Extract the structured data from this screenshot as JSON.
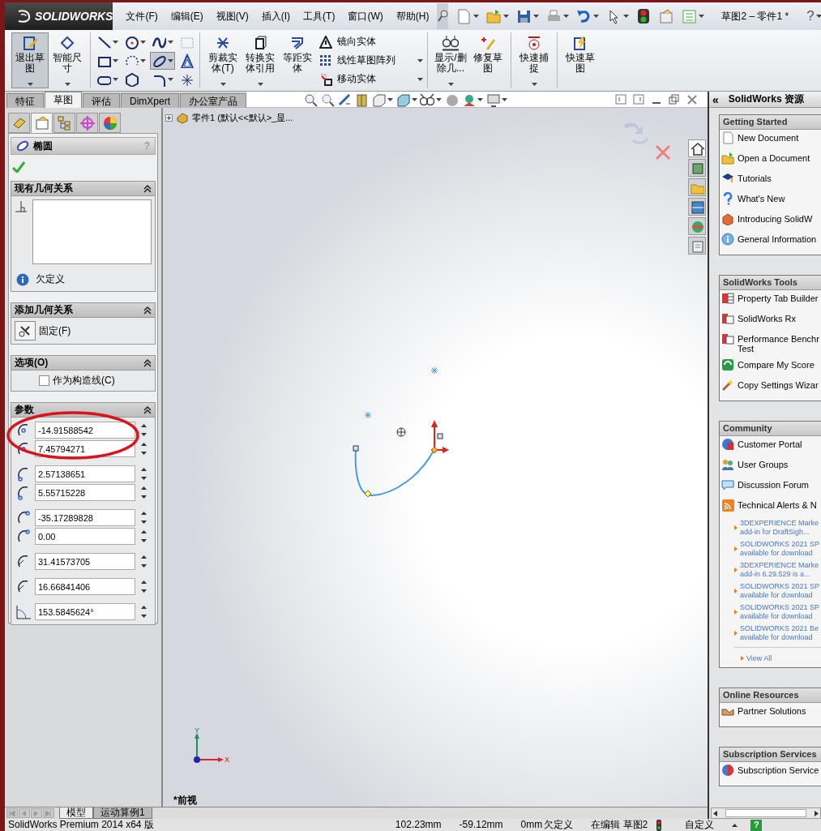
{
  "app": {
    "logo": "SOLIDWORKS",
    "menus": [
      "文件(F)",
      "编辑(E)",
      "视图(V)",
      "插入(I)",
      "工具(T)",
      "窗口(W)",
      "帮助(H)"
    ],
    "document_title": "草图2 – 零件1 *",
    "help": "?"
  },
  "command_manager": {
    "sketch_buttons": [
      {
        "label": "退出草图",
        "selected": true
      },
      {
        "label": "智能尺寸",
        "selected": false
      }
    ],
    "sketch_tools": [
      {
        "selected": false
      },
      {
        "selected": false
      },
      {
        "selected": false
      },
      {
        "selected": false
      },
      {
        "selected": false
      },
      {
        "selected": false
      },
      {
        "selected": true
      },
      {
        "selected": false
      },
      {
        "selected": false
      },
      {
        "selected": false
      },
      {
        "selected": false
      },
      {
        "selected": false
      }
    ],
    "edit_buttons": [
      {
        "label": "剪裁实体(T)",
        "selected": false
      },
      {
        "label": "转换实体引用",
        "selected": false
      },
      {
        "label": "等距实体",
        "selected": false
      }
    ],
    "edit_list": [
      {
        "label": "镜向实体"
      },
      {
        "label": "线性草图阵列"
      },
      {
        "label": "移动实体"
      }
    ],
    "relation_buttons": [
      {
        "label": "显示/删除几...",
        "selected": false
      },
      {
        "label": "修复草图",
        "selected": false
      }
    ],
    "snap_buttons": [
      {
        "label": "快速捕捉",
        "selected": false
      }
    ],
    "quick_buttons": [
      {
        "label": "快速草图",
        "selected": false
      }
    ]
  },
  "tabs": [
    {
      "label": "特征",
      "selected": false
    },
    {
      "label": "草图",
      "selected": true
    },
    {
      "label": "评估",
      "selected": false
    },
    {
      "label": "DimXpert",
      "selected": false
    },
    {
      "label": "办公室产品",
      "selected": false
    }
  ],
  "property_manager": {
    "tabs": [
      {
        "selected": false
      },
      {
        "selected": true
      },
      {
        "selected": false
      },
      {
        "selected": false
      },
      {
        "selected": false
      }
    ],
    "title": "椭圆",
    "help": "?",
    "existing_relations": {
      "title": "现有几何关系",
      "status": "欠定义"
    },
    "add_relations": {
      "title": "添加几何关系",
      "button": "固定(F)"
    },
    "options": {
      "title": "选项(O)",
      "checkbox": {
        "label": "作为构造线(C)",
        "checked": false
      }
    },
    "parameters": {
      "title": "参数",
      "fields": [
        {
          "value": "-14.91588542"
        },
        {
          "value": "7.45794271"
        },
        {
          "value": "2.57138651"
        },
        {
          "value": "5.55715228"
        },
        {
          "value": "-35.17289828"
        },
        {
          "value": "0.00"
        },
        {
          "value": "31.41573705"
        },
        {
          "value": "16.66841406"
        },
        {
          "value": "153.5845624°"
        }
      ]
    }
  },
  "viewport": {
    "breadcrumb": "零件1 (默认<<默认>_显...",
    "view_name": "*前视",
    "triad": {
      "x": "X",
      "y": "Y"
    },
    "side_tabs": [
      {
        "selected": true
      },
      {
        "selected": false
      },
      {
        "selected": false
      },
      {
        "selected": false
      },
      {
        "selected": false
      },
      {
        "selected": false
      }
    ]
  },
  "task_pane": {
    "collapse": "«",
    "title": "SolidWorks 资源",
    "sections": [
      {
        "title": "Getting Started",
        "items": [
          {
            "lines": [
              "New Document"
            ]
          },
          {
            "lines": [
              "Open a Document"
            ]
          },
          {
            "lines": [
              "Tutorials"
            ]
          },
          {
            "lines": [
              "What's New"
            ]
          },
          {
            "lines": [
              "Introducing SolidW"
            ]
          },
          {
            "lines": [
              "General Information"
            ]
          }
        ]
      },
      {
        "title": "SolidWorks Tools",
        "items": [
          {
            "lines": [
              "Property Tab Builder"
            ]
          },
          {
            "lines": [
              "SolidWorks Rx"
            ]
          },
          {
            "lines": [
              "Performance Benchr",
              "Test"
            ]
          },
          {
            "lines": [
              "Compare My Score"
            ]
          },
          {
            "lines": [
              "Copy Settings Wizar"
            ]
          }
        ]
      },
      {
        "title": "Community",
        "items": [
          {
            "lines": [
              "Customer Portal"
            ]
          },
          {
            "lines": [
              "User Groups"
            ]
          },
          {
            "lines": [
              "Discussion Forum"
            ]
          },
          {
            "lines": [
              "Technical Alerts & N"
            ]
          }
        ],
        "news": [
          {
            "lines": [
              "3DEXPERIENCE Marke",
              "add-in for DraftSigh..."
            ]
          },
          {
            "lines": [
              "SOLIDWORKS 2021 SP",
              "available for download"
            ]
          },
          {
            "lines": [
              "3DEXPERIENCE Marke",
              "add-in 6.29.529 is a..."
            ]
          },
          {
            "lines": [
              "SOLIDWORKS 2021 SP",
              "available for download"
            ]
          },
          {
            "lines": [
              "SOLIDWORKS 2021 SP",
              "available for download"
            ]
          },
          {
            "lines": [
              "SOLIDWORKS 2021 Be",
              "available for download"
            ]
          }
        ],
        "view_all": "View All"
      },
      {
        "title": "Online Resources",
        "items": [
          {
            "lines": [
              "Partner Solutions"
            ]
          }
        ]
      },
      {
        "title": "Subscription Services",
        "items": [
          {
            "lines": [
              "Subscription Service"
            ]
          }
        ]
      }
    ]
  },
  "bottom_tabs": [
    {
      "label": "模型",
      "selected": true
    },
    {
      "label": "运动算例1",
      "selected": false
    }
  ],
  "status_bar": {
    "product": "SolidWorks Premium 2014 x64 版",
    "x": "102.23mm",
    "y": "-59.12mm",
    "z": "0mm",
    "state": "欠定义",
    "editing": "在编辑 草图2",
    "units": "自定义",
    "help": "?"
  }
}
